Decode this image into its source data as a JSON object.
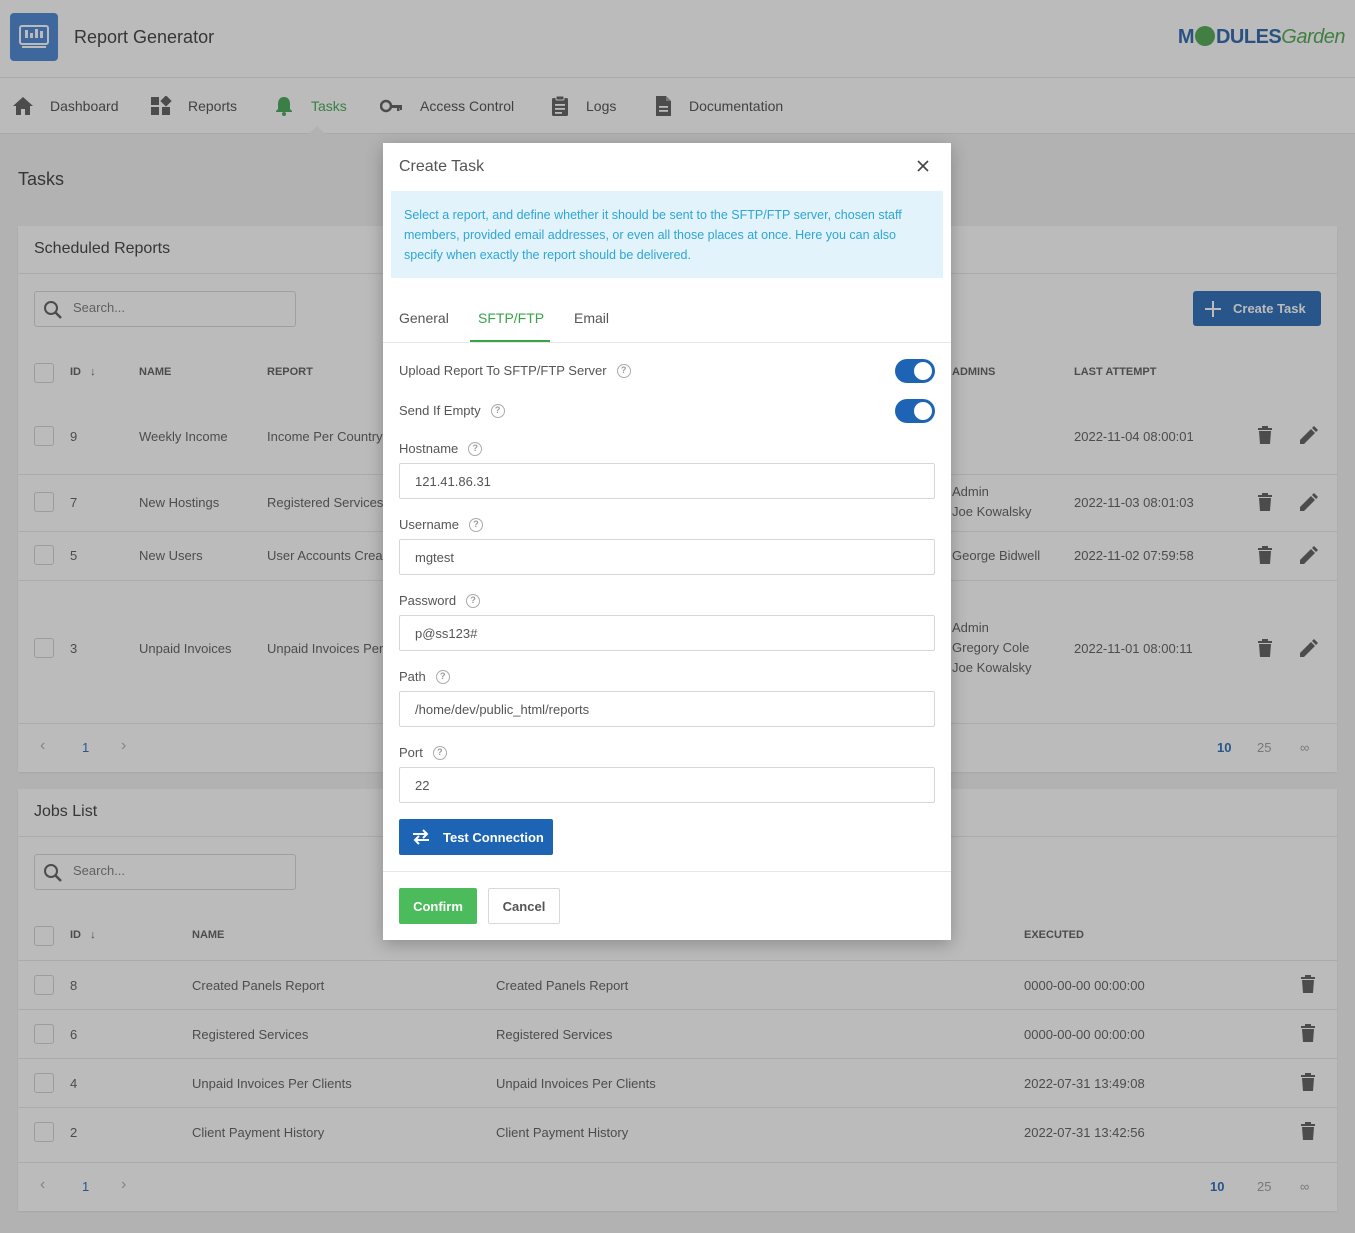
{
  "app": {
    "title": "Report Generator",
    "brand_pre": "M",
    "brand_mid": "DULES",
    "brand_post": "Garden"
  },
  "nav": {
    "items": [
      {
        "label": "Dashboard",
        "icon": "home-icon"
      },
      {
        "label": "Reports",
        "icon": "widgets-icon"
      },
      {
        "label": "Tasks",
        "icon": "bell-icon",
        "active": true
      },
      {
        "label": "Access Control",
        "icon": "key-icon"
      },
      {
        "label": "Logs",
        "icon": "clipboard-icon"
      },
      {
        "label": "Documentation",
        "icon": "document-icon"
      }
    ]
  },
  "page": {
    "title": "Tasks"
  },
  "scheduled": {
    "title": "Scheduled Reports",
    "search_placeholder": "Search...",
    "create_label": "Create Task",
    "headers": {
      "id": "ID",
      "name": "NAME",
      "report": "REPORT",
      "admins": "ADMINS",
      "last_attempt": "LAST ATTEMPT"
    },
    "rows": [
      {
        "id": "9",
        "name": "Weekly Income",
        "report": "Income Per Country",
        "admins": "",
        "last": "2022-11-04 08:00:01"
      },
      {
        "id": "7",
        "name": "New Hostings",
        "report": "Registered Services",
        "admins": "Admin\nJoe Kowalsky",
        "last": "2022-11-03 08:01:03"
      },
      {
        "id": "5",
        "name": "New Users",
        "report": "User Accounts Crea",
        "admins": "George Bidwell",
        "last": "2022-11-02 07:59:58"
      },
      {
        "id": "3",
        "name": "Unpaid Invoices",
        "report": "Unpaid Invoices Per",
        "admins": "Admin\nGregory Cole\nJoe Kowalsky",
        "last": "2022-11-01 08:00:11"
      }
    ],
    "pager": {
      "page": "1",
      "sizes": [
        "10",
        "25",
        "∞"
      ]
    }
  },
  "jobs": {
    "title": "Jobs List",
    "search_placeholder": "Search...",
    "headers": {
      "id": "ID",
      "name": "NAME",
      "executed": "EXECUTED"
    },
    "rows": [
      {
        "id": "8",
        "name": "Created Panels Report",
        "report": "Created Panels Report",
        "executed": "0000-00-00 00:00:00"
      },
      {
        "id": "6",
        "name": "Registered Services",
        "report": "Registered Services",
        "executed": "0000-00-00 00:00:00"
      },
      {
        "id": "4",
        "name": "Unpaid Invoices Per Clients",
        "report": "Unpaid Invoices Per Clients",
        "executed": "2022-07-31 13:49:08"
      },
      {
        "id": "2",
        "name": "Client Payment History",
        "report": "Client Payment History",
        "executed": "2022-07-31 13:42:56"
      }
    ],
    "pager": {
      "page": "1",
      "sizes": [
        "10",
        "25",
        "∞"
      ]
    }
  },
  "modal": {
    "title": "Create Task",
    "info": "Select a report, and define whether it should be sent to the SFTP/FTP server, chosen staff members, provided email addresses, or even all those places at once. Here you can also specify when exactly the report should be delivered.",
    "tabs": [
      "General",
      "SFTP/FTP",
      "Email"
    ],
    "active_tab": "SFTP/FTP",
    "upload_label": "Upload Report To SFTP/FTP Server",
    "upload_enabled": true,
    "send_empty_label": "Send If Empty",
    "send_empty_enabled": true,
    "hostname_label": "Hostname",
    "hostname": "121.41.86.31",
    "username_label": "Username",
    "username": "mgtest",
    "password_label": "Password",
    "password": "p@ss123#",
    "path_label": "Path",
    "path": "/home/dev/public_html/reports",
    "port_label": "Port",
    "port": "22",
    "test_label": "Test Connection",
    "confirm_label": "Confirm",
    "cancel_label": "Cancel"
  },
  "colors": {
    "accent": "#1e64b5",
    "active": "#3aa34a",
    "confirm": "#4cbb5b",
    "info_bg": "#e3f3fb",
    "info_text": "#2ea5d6"
  }
}
